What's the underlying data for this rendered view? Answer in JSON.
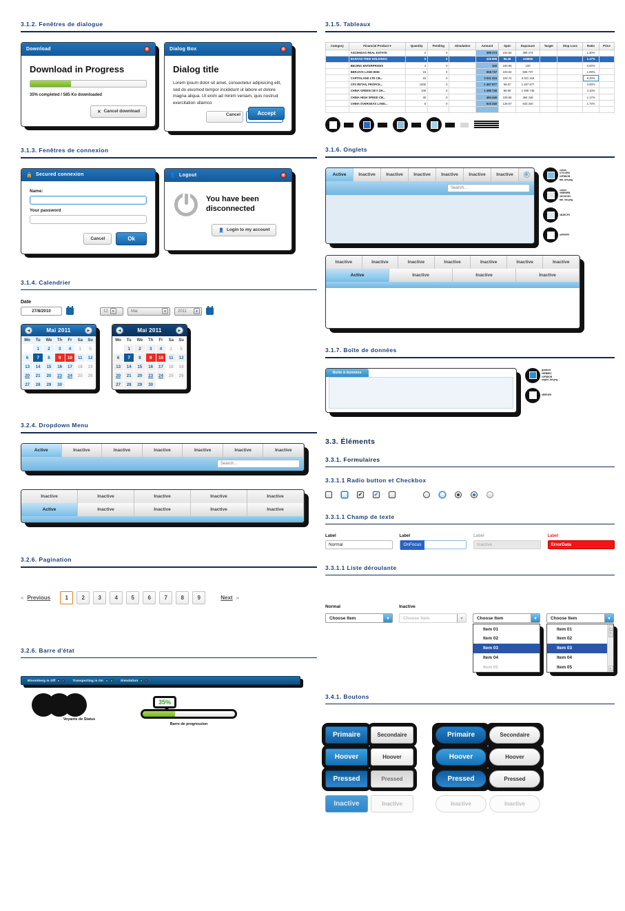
{
  "sections": {
    "dialog": "3.1.2.  Fenêtres de dialogue",
    "connexion": "3.1.3.  Fenêtres de connexion",
    "calendrier": "3.1.4.  Calendrier",
    "dropdown": "3.2.4.  Dropdown Menu",
    "pagination": "3.2.6.  Pagination",
    "barre_etat": "3.2.6.  Barre d'état",
    "tableaux": "3.1.5.  Tableaux",
    "onglets": "3.1.6.  Onglets",
    "boite": "3.1.7.  Boîte de données",
    "elements": "3.3.  Éléments",
    "formulaires": "3.3.1.  Formulaires",
    "radio": "3.3.1.1  Radio button et Checkbox",
    "champ": "3.3.1.1  Champ de texte",
    "liste": "3.3.1.1  Liste déroulante",
    "boutons": "3.4.1.  Boutons"
  },
  "download_dialog": {
    "title": "Download",
    "close": "×",
    "heading": "Download in Progress",
    "progress_percent": 35,
    "progress_caption": "35% completed / 585 Ko downloaded",
    "cancel_label": "Cancel download",
    "cancel_icon": "✕"
  },
  "dialog_box": {
    "title": "Dialog Box",
    "close": "×",
    "heading": "Dialog title",
    "body": "Lorem ipsum dolor sit amet, consectetur adipisicing elit, sed do eiusmod tempor incididunt ut labore et dolore magna aliqua. Ut enim ad minim veniam, quis nostrud exercitation ullamco",
    "cancel_label": "Cancel",
    "accept_label": "Accept"
  },
  "login_dialog": {
    "title": "Secured connexion",
    "lock_icon": "🔒",
    "name_label": "Name:",
    "name_value": "",
    "password_label": "Your password",
    "password_value": "",
    "cancel_label": "Cancel",
    "ok_label": "Ok"
  },
  "logout_dialog": {
    "title": "Logout",
    "user_icon": "👤",
    "close": "×",
    "message": "You have been disconnected",
    "login_label": "Login to my account",
    "login_icon": "👤"
  },
  "calendar_controls": {
    "date_label": "Date",
    "date_value": "27/8/2010",
    "day_select": "12",
    "month_select": "Mai",
    "year_select": "2011"
  },
  "calendar": {
    "title": "Mai 2011",
    "prev": "◀",
    "next": "▶",
    "weekdays": [
      "Mo",
      "Tu",
      "We",
      "Th",
      "Fr",
      "Sa",
      "Su"
    ],
    "weeks": [
      [
        {
          "d": "",
          "t": "empty"
        },
        {
          "d": "1",
          "t": "day"
        },
        {
          "d": "2",
          "t": "day"
        },
        {
          "d": "3",
          "t": "day"
        },
        {
          "d": "4",
          "t": "day"
        },
        {
          "d": "1",
          "t": "mute"
        },
        {
          "d": "5",
          "t": "mute"
        }
      ],
      [
        {
          "d": "6",
          "t": "day"
        },
        {
          "d": "7",
          "t": "sel"
        },
        {
          "d": "8",
          "t": "day"
        },
        {
          "d": "9",
          "t": "red"
        },
        {
          "d": "10",
          "t": "red"
        },
        {
          "d": "11",
          "t": "day"
        },
        {
          "d": "12",
          "t": "day"
        }
      ],
      [
        {
          "d": "13",
          "t": "day"
        },
        {
          "d": "14",
          "t": "day"
        },
        {
          "d": "15",
          "t": "day"
        },
        {
          "d": "16",
          "t": "day"
        },
        {
          "d": "17",
          "t": "day"
        },
        {
          "d": "18",
          "t": "mute"
        },
        {
          "d": "19",
          "t": "mute"
        }
      ],
      [
        {
          "d": "20",
          "t": "under"
        },
        {
          "d": "21",
          "t": "day"
        },
        {
          "d": "20",
          "t": "day"
        },
        {
          "d": "23",
          "t": "under"
        },
        {
          "d": "24",
          "t": "under"
        },
        {
          "d": "25",
          "t": "mute"
        },
        {
          "d": "26",
          "t": "mute"
        }
      ],
      [
        {
          "d": "27",
          "t": "day"
        },
        {
          "d": "28",
          "t": "day"
        },
        {
          "d": "29",
          "t": "day"
        },
        {
          "d": "30",
          "t": "day"
        },
        {
          "d": "",
          "t": "empty"
        },
        {
          "d": "",
          "t": "empty"
        },
        {
          "d": "",
          "t": "empty"
        }
      ]
    ]
  },
  "dropdown_menu": {
    "tabs_row1": [
      "Active",
      "Inactive",
      "Inactive",
      "Inactive",
      "Inactive",
      "Inactive",
      "Inactive"
    ],
    "search_placeholder": "Search...",
    "tabs_row2_top": [
      "Inactive",
      "Inactive",
      "Inactive",
      "Inactive",
      "Inactive"
    ],
    "tabs_row2_bottom": [
      "Active",
      "Inactive",
      "Inactive",
      "Inactive",
      "Inactive"
    ]
  },
  "pagination": {
    "previous": "Previous",
    "prev_chevron": "«",
    "next": "Next",
    "next_chevron": "»",
    "pages": [
      "1",
      "2",
      "3",
      "4",
      "5",
      "6",
      "7",
      "8",
      "9"
    ],
    "current": "1"
  },
  "status_bar": {
    "items": [
      {
        "label": "Bloomberg is Off",
        "leds": [
          "grey",
          "red"
        ]
      },
      {
        "label": "Transporting is On",
        "leds": [
          "grey",
          "green"
        ]
      },
      {
        "label": "Simulation",
        "leds": [
          "green",
          "red"
        ]
      }
    ],
    "lights_caption": "Voyants de Status",
    "progress_caption": "Barre de progression",
    "progress_percent": "35%",
    "progress_value": 35
  },
  "tableaux": {
    "headers": [
      "Category",
      "Financial Product",
      "Quantity",
      "Pending",
      "Simulation",
      "Amount",
      "Spot",
      "Exposure",
      "Target",
      "Stop Loss",
      "Ratio",
      "Price"
    ],
    "sort_marker": "▾",
    "rows": [
      {
        "product": "ASCENDAS REAL ESTATE",
        "qty": "2",
        "pending": "0",
        "amount": "399 274",
        "spot": "102.82",
        "exposure": "399 274",
        "ratio": "1.30%",
        "selected": false,
        "boxed": false
      },
      {
        "product": "BANYAN TREE HOLDINGS",
        "qty": "5",
        "pending": "0",
        "amount": "426 896",
        "spot": "85.38",
        "exposure": "426896",
        "ratio": "1.17%",
        "selected": true,
        "boxed": false
      },
      {
        "product": "BEIJING ENTERPRISES",
        "qty": "4",
        "pending": "0",
        "amount": "100",
        "spot": "190.96",
        "exposure": "100",
        "ratio": "0.00%",
        "selected": false,
        "boxed": false
      },
      {
        "product": "BERJAYA LAND BHD",
        "qty": "15",
        "pending": "0",
        "amount": "506 737",
        "spot": "103.02",
        "exposure": "506 737",
        "ratio": "1.09%",
        "selected": false,
        "boxed": false
      },
      {
        "product": "CAPITALAND LTD CB...",
        "qty": "15",
        "pending": "0",
        "amount": "3 021 416",
        "spot": "103.74",
        "exposure": "3 021 416",
        "ratio": "8.29%",
        "selected": false,
        "boxed": true
      },
      {
        "product": "CFS RETAIL PROPCE...",
        "qty": "1500",
        "pending": "0",
        "amount": "1 457 877",
        "spot": "96.67",
        "exposure": "1 457 877",
        "ratio": "4.00%",
        "selected": false,
        "boxed": false
      },
      {
        "product": "CHINA GREEN CB 0 OK...",
        "qty": "100",
        "pending": "0",
        "amount": "1 496 746",
        "spot": "96.68",
        "exposure": "1 496 746",
        "ratio": "4.10%",
        "selected": false,
        "boxed": false
      },
      {
        "product": "CHINA HIGH SPEED CB...",
        "qty": "30",
        "pending": "0",
        "amount": "494 446",
        "spot": "108.66",
        "exposure": "494 446",
        "ratio": "1.17%",
        "selected": false,
        "boxed": false
      },
      {
        "product": "CHINA OVERSEAS LAND...",
        "qty": "5",
        "pending": "0",
        "amount": "633 340",
        "spot": "126.67",
        "exposure": "633 340",
        "ratio": "1.74%",
        "selected": false,
        "boxed": false
      }
    ]
  },
  "onglets": {
    "tabs": [
      "Active",
      "Inactive",
      "Inactive",
      "Inactive",
      "Inactive",
      "Inactive",
      "Inactive"
    ],
    "search_placeholder": "Search...",
    "close_icon": "⊗",
    "tabs_row_top": [
      "Inactive",
      "Inactive",
      "Inactive",
      "Inactive",
      "Inactive",
      "Inactive",
      "Inactive"
    ],
    "tabs_row_bottom": [
      "Active",
      "Inactive",
      "Inactive",
      "Inactive"
    ],
    "swatches": [
      {
        "color": "#7cc0e8"
      },
      {
        "color": "#e8e8e8"
      },
      {
        "color": "#dfe8f0"
      },
      {
        "color": "#ffffff"
      }
    ]
  },
  "boite_donnees": {
    "tab_label": "Boîte à données",
    "swatches": [
      {
        "color": "#2f8dcb"
      },
      {
        "color": "#ffffff"
      }
    ]
  },
  "form_controls": {
    "checkboxes": [
      {
        "state": "normal"
      },
      {
        "state": "focus"
      },
      {
        "state": "checked"
      },
      {
        "state": "checked-blue"
      },
      {
        "state": "empty"
      }
    ],
    "radios": [
      {
        "state": "normal"
      },
      {
        "state": "focus"
      },
      {
        "state": "dot"
      },
      {
        "state": "dot-blue"
      },
      {
        "state": "light"
      }
    ]
  },
  "text_fields": [
    {
      "label": "Label",
      "value": "Normal",
      "state": "normal"
    },
    {
      "label": "Label",
      "value": "OnFocus",
      "state": "focus"
    },
    {
      "label": "Label",
      "value": "Inactive",
      "state": "inactive"
    },
    {
      "label": "Label",
      "value": "ErrorData",
      "state": "error"
    }
  ],
  "selects": {
    "label_normal": "Normal",
    "label_inactive": "Inactive",
    "placeholder": "Choose Item",
    "options_a": [
      {
        "text": "Item 01",
        "state": "normal"
      },
      {
        "text": "Item 02",
        "state": "normal"
      },
      {
        "text": "Item 03",
        "state": "selected"
      },
      {
        "text": "Item 04",
        "state": "normal"
      },
      {
        "text": "Item 05",
        "state": "dim"
      }
    ],
    "options_b": [
      {
        "text": "Item 01",
        "state": "normal"
      },
      {
        "text": "Item 02",
        "state": "normal"
      },
      {
        "text": "Item 03",
        "state": "selected"
      },
      {
        "text": "Item 04",
        "state": "normal"
      },
      {
        "text": "Item 05",
        "state": "normal"
      }
    ],
    "arrow": "▾",
    "scroll_up": "▴",
    "scroll_down": "▾"
  },
  "buttons": {
    "square": [
      {
        "primary": "Primaire",
        "secondary": "Secondaire"
      },
      {
        "primary": "Hoover",
        "secondary": "Hoover"
      },
      {
        "primary": "Pressed",
        "secondary": "Pressed"
      },
      {
        "primary": "Inactive",
        "secondary": "Inactive"
      }
    ],
    "rounded": [
      {
        "primary": "Primaire",
        "secondary": "Secondaire"
      },
      {
        "primary": "Hoover",
        "secondary": "Hoover"
      },
      {
        "primary": "Pressed",
        "secondary": "Pressed"
      },
      {
        "primary": "Inactive",
        "secondary": "Inactive"
      }
    ]
  },
  "colors": {
    "brand_blue": "#1565a8",
    "accent_light_blue": "#7cc0e8",
    "heading_navy": "#12294e",
    "error_red": "#f41414",
    "progress_green": "#74b327",
    "select_highlight": "#2a55a8"
  }
}
